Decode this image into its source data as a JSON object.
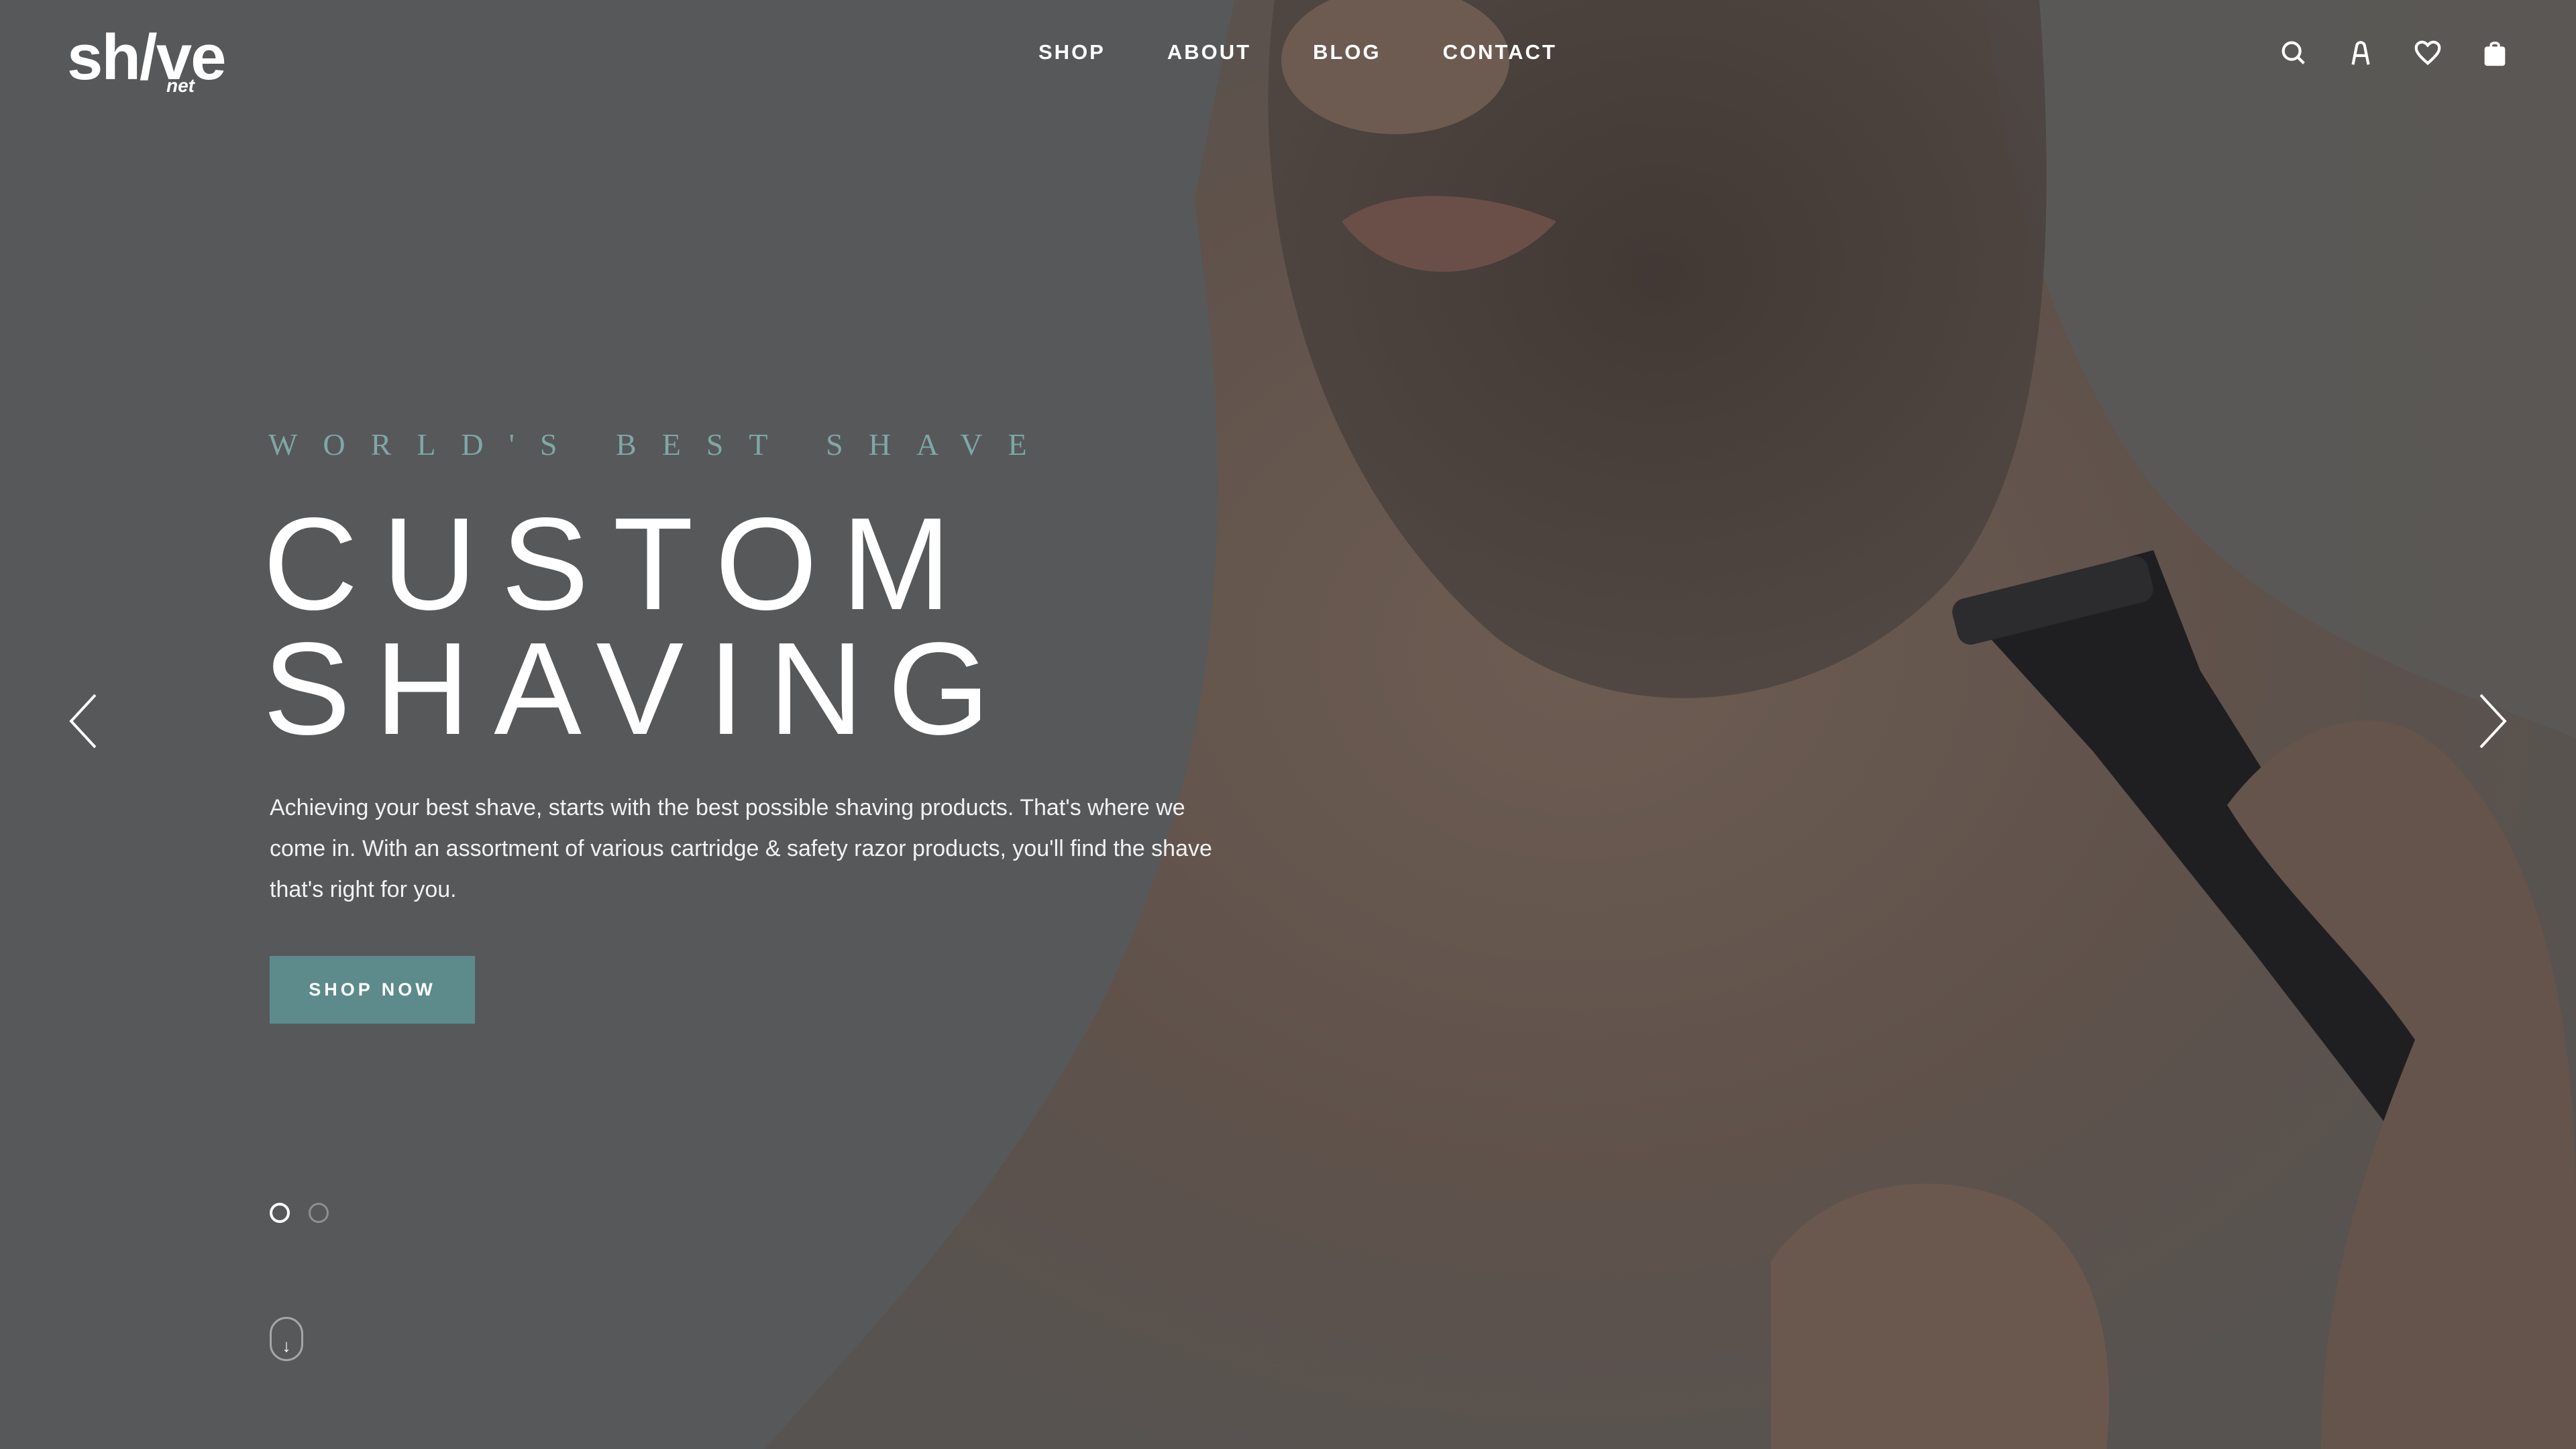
{
  "brand": {
    "logo_text": "sh/ve",
    "logo_sub": "net"
  },
  "nav": {
    "items": [
      "SHOP",
      "ABOUT",
      "BLOG",
      "CONTACT"
    ]
  },
  "header_icons": [
    "search-icon",
    "account-icon",
    "wishlist-heart-icon",
    "shopping-bag-icon"
  ],
  "hero": {
    "eyebrow": "WORLD'S BEST SHAVE",
    "title_line1": "CUSTOM",
    "title_line2": "SHAVING",
    "description": "Achieving your best shave, starts with the best possible shaving products. That's where we come in. With an assortment of various cartridge & safety razor products, you'll find the shave that's right for you.",
    "cta_label": "SHOP NOW"
  },
  "slider": {
    "slides_count": 2,
    "active_slide": 1
  },
  "scroll_down_label": "↓",
  "colors": {
    "accent": "#5d8b8c",
    "eyebrow": "#7fa7a6",
    "overlay": "#555657"
  }
}
